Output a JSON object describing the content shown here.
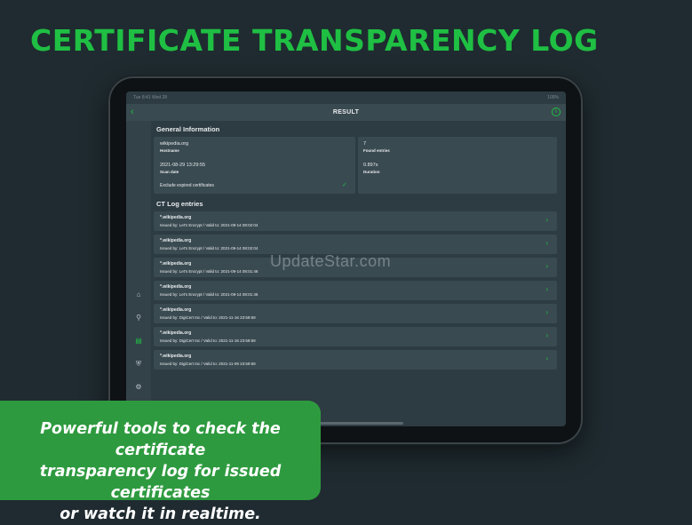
{
  "headline": "CERTIFICATE TRANSPARENCY LOG",
  "status_bar": {
    "left": "Tue 8:41 Wed 28",
    "right": "100%"
  },
  "nav": {
    "title": "RESULT",
    "back_icon": "chevron-left-icon",
    "info_icon": "info-icon"
  },
  "sidebar": {
    "items": [
      {
        "icon": "home-icon",
        "active": false
      },
      {
        "icon": "search-icon",
        "active": false
      },
      {
        "icon": "certificate-icon",
        "active": true
      },
      {
        "icon": "shield-icon",
        "active": false
      },
      {
        "icon": "gear-icon",
        "active": false
      },
      {
        "icon": "chat-icon",
        "active": false
      },
      {
        "icon": "info-icon",
        "active": false
      }
    ]
  },
  "general": {
    "title": "General Information",
    "hostname_value": "wikipedia.org",
    "hostname_label": "Hostname",
    "scan_date_value": "2021-08-29 13:29:55",
    "scan_date_label": "Scan date",
    "exclude_label": "Exclude expired certificates",
    "found_value": "7",
    "found_label": "Found entries",
    "duration_value": "0.897s",
    "duration_label": "Duration"
  },
  "ct_log": {
    "title": "CT Log entries",
    "entries": [
      {
        "name": "*.wikipedia.org",
        "detail": "Issued by: Let's Encrypt / Valid to: 2021-09-14 08:02:04"
      },
      {
        "name": "*.wikipedia.org",
        "detail": "Issued by: Let's Encrypt / Valid to: 2021-09-14 08:02:04"
      },
      {
        "name": "*.wikipedia.org",
        "detail": "Issued by: Let's Encrypt / Valid to: 2021-09-14 08:01:46"
      },
      {
        "name": "*.wikipedia.org",
        "detail": "Issued by: Let's Encrypt / Valid to: 2021-09-14 08:01:46"
      },
      {
        "name": "*.wikipedia.org",
        "detail": "Issued by: DigiCert Inc / Valid to: 2021-11-16 23:59:59"
      },
      {
        "name": "*.wikipedia.org",
        "detail": "Issued by: DigiCert Inc / Valid to: 2021-11-16 23:59:59"
      },
      {
        "name": "*.wikipedia.org",
        "detail": "Issued by: DigiCert Inc / Valid to: 2021-11-09 23:59:59"
      }
    ]
  },
  "watermark": "UpdateStar.com",
  "banner": {
    "line1": "Powerful tools to check the certificate",
    "line2": "transparency log for issued certificates",
    "line3": "or watch it in realtime."
  },
  "colors": {
    "accent": "#1fbf43",
    "background": "#1f2b30",
    "card": "#3a4a51",
    "banner": "#2e9a3f"
  }
}
